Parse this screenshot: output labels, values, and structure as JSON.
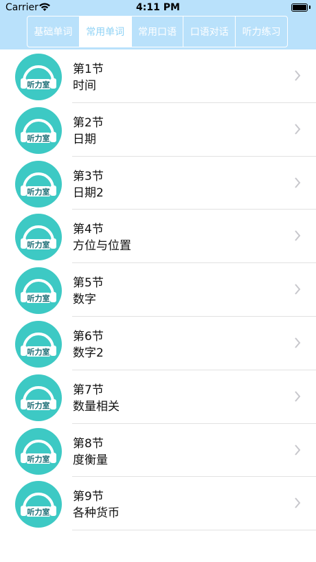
{
  "status": {
    "carrier": "Carrier",
    "time": "4:11 PM"
  },
  "tabs": [
    {
      "label": "基础单词"
    },
    {
      "label": "常用单词"
    },
    {
      "label": "常用口语"
    },
    {
      "label": "口语对话"
    },
    {
      "label": "听力练习"
    }
  ],
  "selected_tab": "常用单词",
  "thumb_label": "听力室",
  "colors": {
    "bar": "#b9e1fb",
    "active_text": "#8fd2f5",
    "thumb_bg": "#3dc9c4"
  },
  "items": [
    {
      "title": "第1节",
      "subtitle": "时间"
    },
    {
      "title": "第2节",
      "subtitle": "日期"
    },
    {
      "title": "第3节",
      "subtitle": "日期2"
    },
    {
      "title": "第4节",
      "subtitle": "方位与位置"
    },
    {
      "title": "第5节",
      "subtitle": "数字"
    },
    {
      "title": "第6节",
      "subtitle": "数字2"
    },
    {
      "title": "第7节",
      "subtitle": "数量相关"
    },
    {
      "title": "第8节",
      "subtitle": "度衡量"
    },
    {
      "title": "第9节",
      "subtitle": "各种货币"
    }
  ]
}
